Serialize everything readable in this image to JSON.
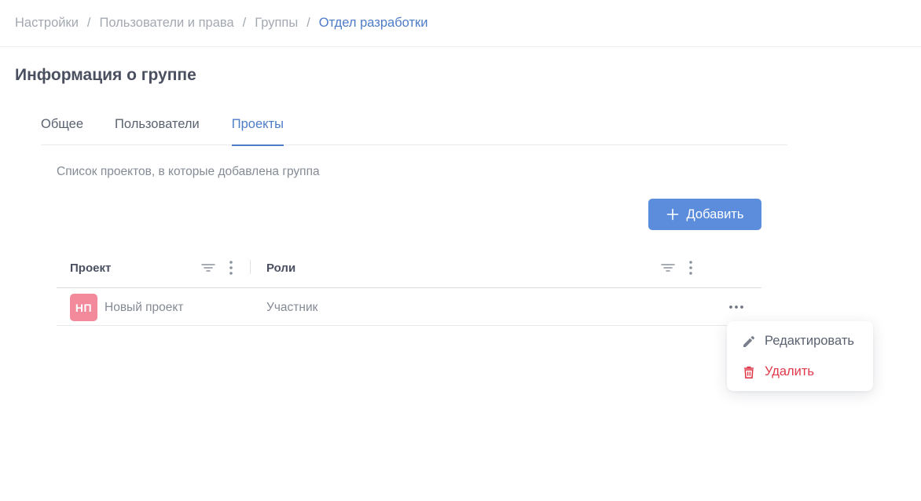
{
  "breadcrumb": {
    "items": [
      "Настройки",
      "Пользователи и права",
      "Группы",
      "Отдел разработки"
    ],
    "separator": "/"
  },
  "page": {
    "title": "Информация о группе",
    "subtitle": "Список проектов, в которые добавлена группа"
  },
  "tabs": [
    {
      "label": "Общее",
      "active": false
    },
    {
      "label": "Пользователи",
      "active": false
    },
    {
      "label": "Проекты",
      "active": true
    }
  ],
  "actions": {
    "add_label": "Добавить"
  },
  "table": {
    "columns": [
      "Проект",
      "Роли"
    ],
    "rows": [
      {
        "avatar": "НП",
        "project": "Новый проект",
        "role": "Участник"
      }
    ]
  },
  "row_menu": {
    "items": [
      {
        "label": "Редактировать",
        "icon": "pencil-icon"
      },
      {
        "label": "Удалить",
        "icon": "trash-icon"
      }
    ]
  },
  "colors": {
    "accent": "#4d7cc7",
    "button": "#5b8ddc",
    "avatar": "#f28a9b",
    "danger": "#e0394a"
  }
}
